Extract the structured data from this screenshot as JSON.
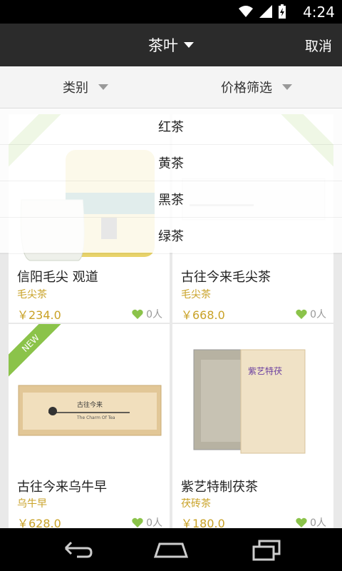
{
  "status_bar": {
    "time": "4:24"
  },
  "header": {
    "title": "茶叶",
    "cancel_label": "取消"
  },
  "filters": {
    "category_label": "类别",
    "price_label": "价格筛选"
  },
  "dropdown": {
    "items": [
      "红茶",
      "黄茶",
      "黑茶",
      "绿茶"
    ]
  },
  "products": [
    {
      "name": "信阳毛尖 观道",
      "category": "毛尖茶",
      "price": "￥234.0",
      "likes": "0人"
    },
    {
      "name": "古往今来毛尖茶",
      "category": "毛尖茶",
      "price": "￥668.0",
      "likes": "0人"
    },
    {
      "name": "古往今来乌牛早",
      "category": "乌牛早",
      "price": "￥628.0",
      "likes": "0人",
      "badge": "NEW",
      "box_text": "古往今来",
      "box_sub": "The Charm Of Tea"
    },
    {
      "name": "紫艺特制茯茶",
      "category": "茯砖茶",
      "price": "￥180.0",
      "likes": "0人",
      "box_text": "紫艺特茯"
    }
  ],
  "colors": {
    "accent": "#c9a227",
    "like_icon": "#8bc34a",
    "ribbon": "#8bc34a",
    "appbar": "#2b2b2b"
  }
}
